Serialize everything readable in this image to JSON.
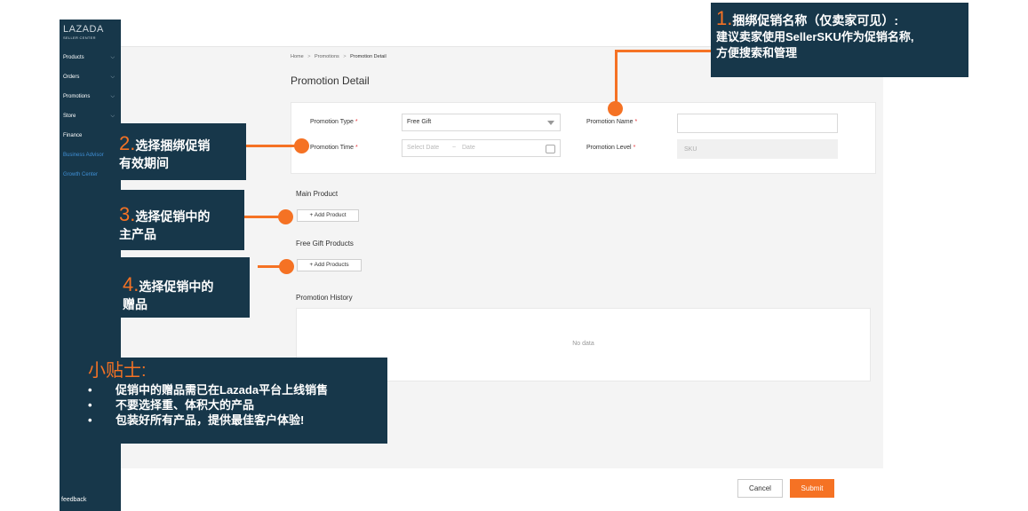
{
  "sidebar": {
    "logo_title": "LAZADA",
    "logo_subtitle": "SELLER CENTER",
    "items": [
      {
        "label": "Products"
      },
      {
        "label": "Orders"
      },
      {
        "label": "Promotions"
      },
      {
        "label": "Store"
      },
      {
        "label": "Finance"
      },
      {
        "label": "Business Advisor"
      },
      {
        "label": "Growth Center"
      }
    ],
    "feedback": "feedback"
  },
  "breadcrumb": {
    "home": "Home",
    "sep": ">",
    "promotions": "Promotions",
    "current": "Promotion Detail"
  },
  "page_title": "Promotion Detail",
  "form": {
    "type_label": "Promotion Type",
    "type_value": "Free Gift",
    "name_label": "Promotion Name",
    "name_value": "",
    "time_label": "Promotion Time",
    "start_placeholder": "Select Date",
    "range_sep": "~",
    "end_placeholder": "Date",
    "level_label": "Promotion Level",
    "level_value": "SKU",
    "required_mark": "*"
  },
  "main_product": {
    "label": "Main Product",
    "button": "+ Add Product"
  },
  "free_gift": {
    "label": "Free Gift Products",
    "button": "+ Add Products"
  },
  "history": {
    "label": "Promotion History",
    "empty": "No data"
  },
  "actions": {
    "cancel": "Cancel",
    "submit": "Submit"
  },
  "callouts": {
    "c1": {
      "num": "1.",
      "title": "捆绑促销名称（仅卖家可见）:",
      "line2": "建议卖家使用SellerSKU作为促销名称,",
      "line3": "方便搜索和管理"
    },
    "c2": {
      "num": "2.",
      "title": "选择捆绑促销",
      "line2": "有效期间"
    },
    "c3": {
      "num": "3.",
      "title": "选择促销中的",
      "line2": "主产品"
    },
    "c4": {
      "num": "4.",
      "title": "选择促销中的",
      "line2": "赠品"
    }
  },
  "tips": {
    "title": "小贴士:",
    "bullet": "•",
    "items": [
      "促销中的赠品需已在Lazada平台上线销售",
      "不要选择重、体积大的产品",
      "包装好所有产品，提供最佳客户体验!"
    ]
  },
  "colors": {
    "accent": "#f57224",
    "navy": "#17374a",
    "link": "#3f8fd6"
  }
}
